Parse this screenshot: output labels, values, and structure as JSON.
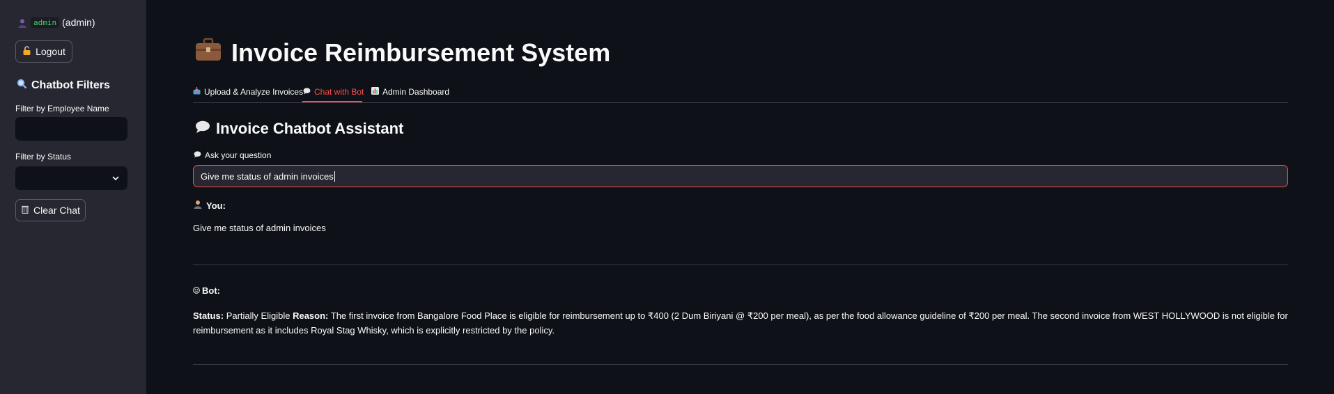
{
  "sidebar": {
    "user": {
      "code": "admin",
      "role": "(admin)"
    },
    "logout_label": "Logout",
    "filters_title": "Chatbot Filters",
    "employee_filter": {
      "label": "Filter by Employee Name",
      "value": ""
    },
    "status_filter": {
      "label": "Filter by Status",
      "value": ""
    },
    "clear_chat_label": "Clear Chat"
  },
  "main": {
    "title": "Invoice Reimbursement System",
    "tabs": [
      {
        "label": "Upload & Analyze Invoices",
        "active": false
      },
      {
        "label": "Chat with Bot",
        "active": true
      },
      {
        "label": "Admin Dashboard",
        "active": false
      }
    ],
    "section_title": "Invoice Chatbot Assistant",
    "ask_label": "Ask your question",
    "question_value": "Give me status of admin invoices",
    "chat": {
      "you_label": "You:",
      "you_text": "Give me status of admin invoices",
      "bot_label": "Bot:",
      "status_label": "Status:",
      "status_value": "Partially Eligible",
      "reason_label": "Reason:",
      "reason_text": "The first invoice from Bangalore Food Place is eligible for reimbursement up to ₹400 (2 Dum Biriyani @ ₹200 per meal), as per the food allowance guideline of ₹200 per meal. The second invoice from WEST HOLLYWOOD is not eligible for reimbursement as it includes Royal Stag Whisky, which is explicitly restricted by the policy."
    }
  },
  "colors": {
    "accent": "#ff4b4b",
    "sidebar_bg": "#262730",
    "main_bg": "#0e1117"
  }
}
